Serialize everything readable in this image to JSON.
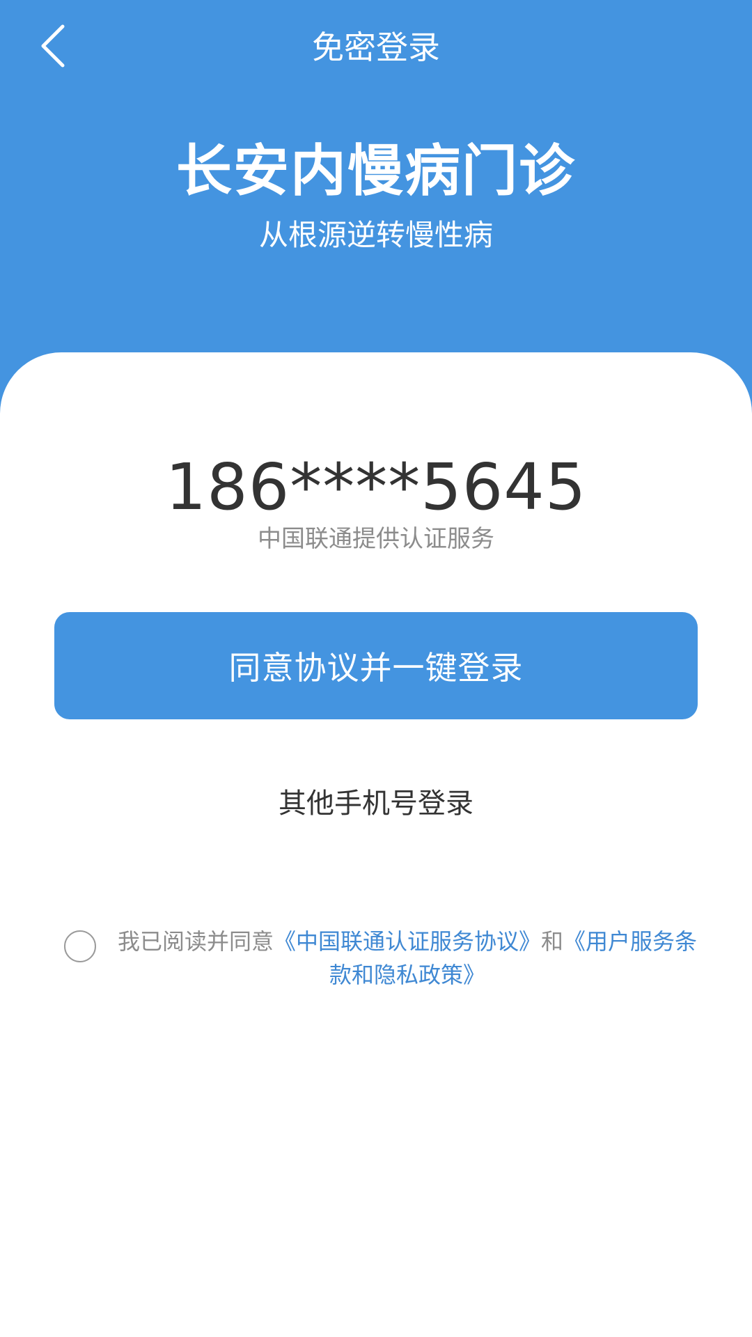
{
  "header": {
    "back_icon": "chevron-left-icon",
    "nav_title": "免密登录",
    "app_name": "长安内慢病门诊",
    "slogan": "从根源逆转慢性病",
    "background_color": "#4494e0"
  },
  "main": {
    "phone_number": "186****5645",
    "provider_text": "中国联通提供认证服务",
    "login_button_label": "同意协议并一键登录",
    "other_login_label": "其他手机号登录"
  },
  "agreement": {
    "checked": false,
    "prefix": "我已阅读并同意",
    "link1": "《中国联通认证服务协议》",
    "conjunction": "和",
    "link2": "《用户服务条款和隐私政策》",
    "link_color": "#3f88d3"
  }
}
